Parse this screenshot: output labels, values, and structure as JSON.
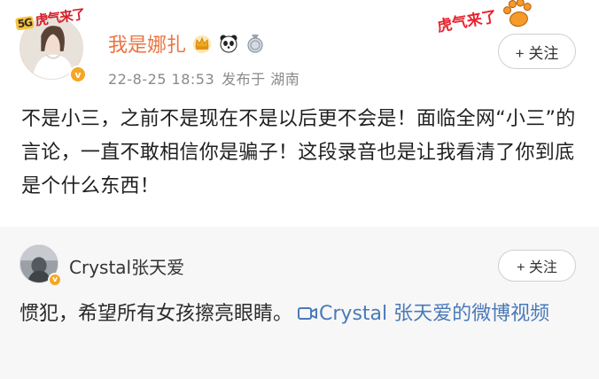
{
  "post": {
    "username": "我是娜扎",
    "avatar_deco_text": "虎气来了",
    "avatar_deco_mini": "5G",
    "verified_mark": "v",
    "badges": [
      "crown-icon",
      "panda-icon",
      "medal-icon"
    ],
    "date": "22-8-25 18:53",
    "published_in": "发布于 湖南",
    "sticker_text": "虎气来了",
    "follow_label": "+ 关注",
    "content": "不是小三，之前不是现在不是以后更不会是！面临全网“小三”的言论，一直不敢相信你是骗子！这段录音也是让我看清了你到底是个什么东西！"
  },
  "repost": {
    "username": "Crystal张天爱",
    "verified_mark": "v",
    "follow_label": "+ 关注",
    "content": "惯犯，希望所有女孩擦亮眼睛。",
    "video_link_label": "Crystal 张天爱的微博视频",
    "video_icon": "video-camera-icon"
  },
  "colors": {
    "username": "#eb7340",
    "link": "#4a79b8",
    "meta": "#8a8a8a",
    "repost_bg": "#f7f7f7"
  }
}
